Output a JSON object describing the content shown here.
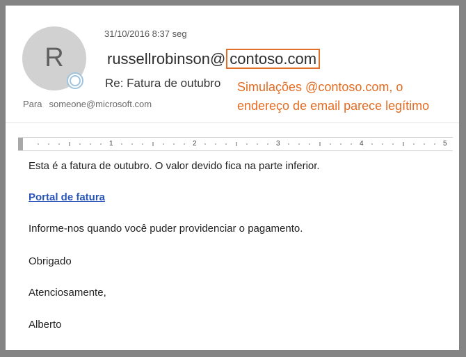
{
  "email": {
    "avatar_letter": "R",
    "date": "31/10/2016 8:37 seg",
    "sender_user": "russellrobinson@",
    "sender_domain": "contoso.com",
    "subject": "Re: Fatura de outubro",
    "to_label": "Para",
    "to_address": "someone@microsoft.com"
  },
  "annotation": {
    "line1": "Simulações @contoso.com, o",
    "line2": "endereço de email parece legítimo",
    "color": "#e36b21"
  },
  "ruler": {
    "numbers": [
      "1",
      "2",
      "3",
      "4",
      "5"
    ]
  },
  "body": {
    "line1": "Esta é a fatura de outubro. O valor devido fica na parte inferior.",
    "link_text": "Portal de fatura",
    "line2": "Informe-nos quando você puder providenciar o pagamento.",
    "line3": "Obrigado",
    "closing": "Atenciosamente,",
    "signature": "Alberto"
  }
}
